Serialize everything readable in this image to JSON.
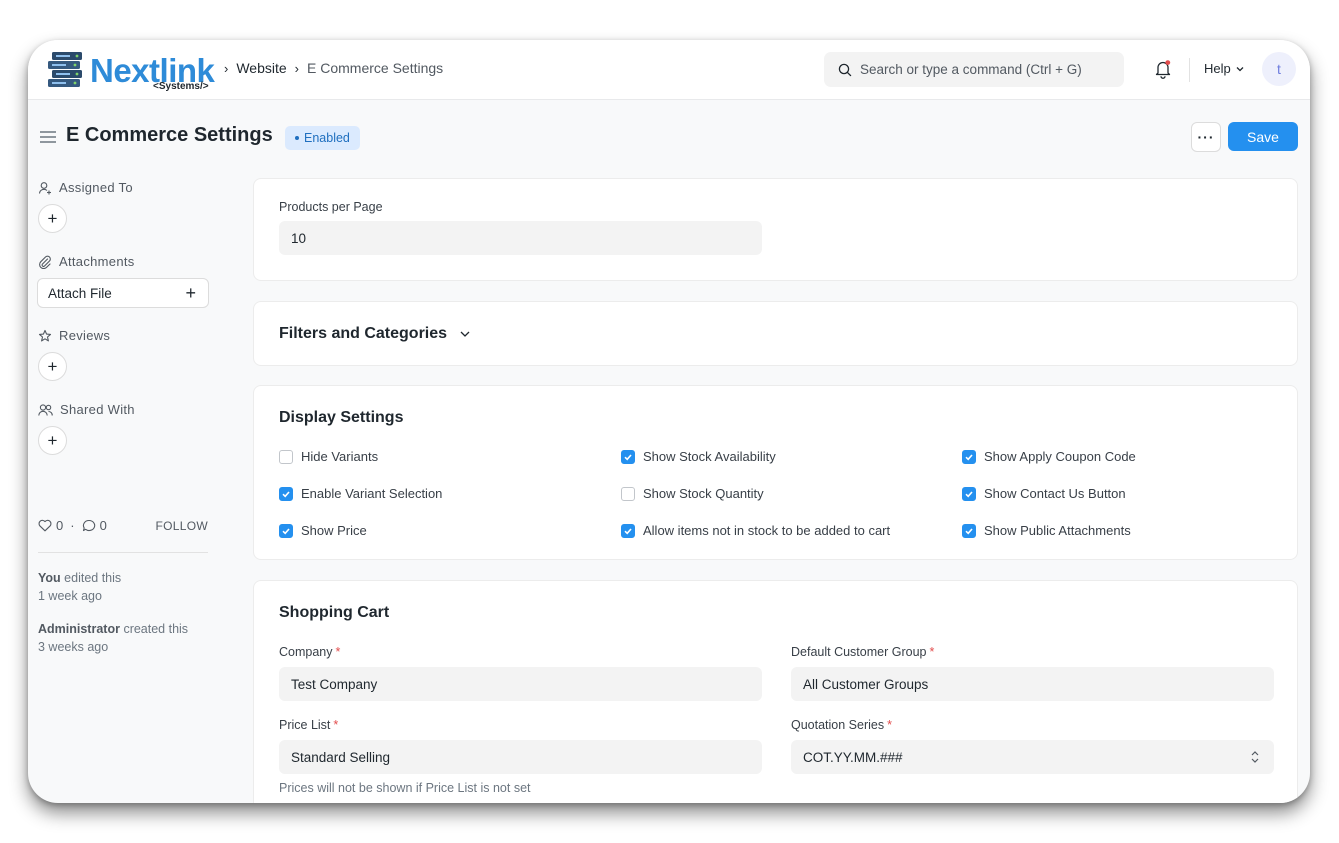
{
  "brand": {
    "name": "Nextlink",
    "tagline": "<Systems/>"
  },
  "breadcrumbs": [
    "Website",
    "E Commerce Settings"
  ],
  "search": {
    "placeholder": "Search or type a command (Ctrl + G)"
  },
  "navbar": {
    "help_label": "Help",
    "avatar_letter": "t"
  },
  "page": {
    "title": "E Commerce Settings",
    "status": "Enabled",
    "more_label": "···",
    "save_label": "Save"
  },
  "sidebar": {
    "assigned_to": "Assigned To",
    "attachments": "Attachments",
    "attach_file": "Attach File",
    "reviews": "Reviews",
    "shared_with": "Shared With",
    "likes": "0",
    "comments": "0",
    "follow": "FOLLOW",
    "activity": [
      {
        "who": "You",
        "action": "edited this",
        "when": "1 week ago"
      },
      {
        "who": "Administrator",
        "action": "created this",
        "when": "3 weeks ago"
      }
    ]
  },
  "products_per_page": {
    "label": "Products per Page",
    "value": "10"
  },
  "filters": {
    "title": "Filters and Categories"
  },
  "display_settings": {
    "title": "Display Settings",
    "options": [
      {
        "label": "Hide Variants",
        "checked": false
      },
      {
        "label": "Enable Variant Selection",
        "checked": true
      },
      {
        "label": "Show Price",
        "checked": true
      },
      {
        "label": "Show Stock Availability",
        "checked": true
      },
      {
        "label": "Show Stock Quantity",
        "checked": false
      },
      {
        "label": "Allow items not in stock to be added to cart",
        "checked": true
      },
      {
        "label": "Show Apply Coupon Code",
        "checked": true
      },
      {
        "label": "Show Contact Us Button",
        "checked": true
      },
      {
        "label": "Show Public Attachments",
        "checked": true
      }
    ]
  },
  "shopping_cart": {
    "title": "Shopping Cart",
    "company_label": "Company",
    "company_value": "Test Company",
    "customer_group_label": "Default Customer Group",
    "customer_group_value": "All Customer Groups",
    "price_list_label": "Price List",
    "price_list_value": "Standard Selling",
    "price_list_help": "Prices will not be shown if Price List is not set",
    "quotation_series_label": "Quotation Series",
    "quotation_series_value": "COT.YY.MM.###",
    "required_mark": "*"
  },
  "colors": {
    "primary": "#2490ef",
    "brand": "#2e8bd8",
    "badge_bg": "#dbeafe",
    "required": "#e24c4c"
  }
}
